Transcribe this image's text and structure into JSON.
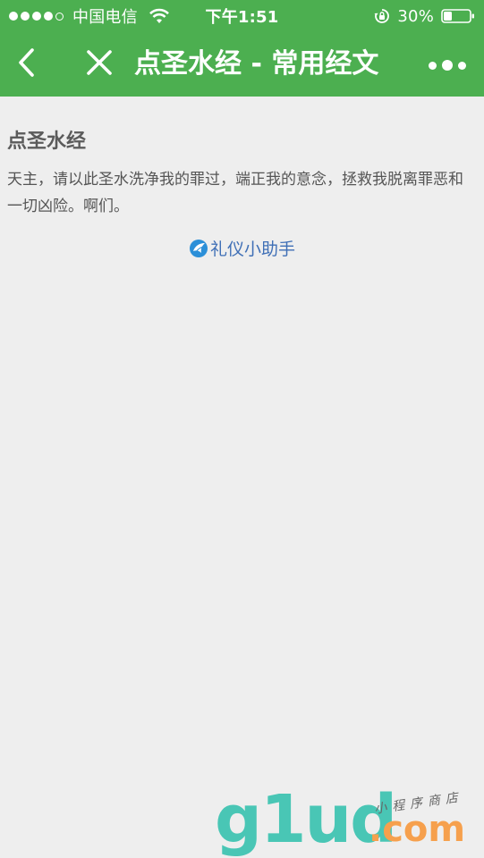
{
  "status_bar": {
    "carrier": "中国电信",
    "time": "下午1:51",
    "battery": "30%",
    "signal_strength": {
      "filled": 4,
      "total": 5
    },
    "icons": [
      "signal-dots-icon",
      "wifi-icon",
      "rotation-lock-icon",
      "battery-icon"
    ]
  },
  "navbar": {
    "title": "点圣水经 - 常用经文",
    "icons": [
      "back-chevron-icon",
      "close-icon",
      "more-dots-icon"
    ]
  },
  "content": {
    "title": "点圣水经",
    "body": "天主，请以此圣水洗净我的罪过，端正我的意念，拯救我脱离罪恶和一切凶险。啊们。",
    "brand_label": "礼仪小助手",
    "brand_icon": "bird-logo-icon"
  },
  "watermark": {
    "main": "g1ud",
    "dotcom": ".com",
    "tagline": "小程序商店"
  },
  "colors": {
    "navbar_bg": "#4caf50",
    "page_bg": "#eeeeee",
    "brand_link": "#3f6fb6",
    "watermark_teal": "#49c6b5",
    "watermark_orange": "#f6a04d"
  }
}
